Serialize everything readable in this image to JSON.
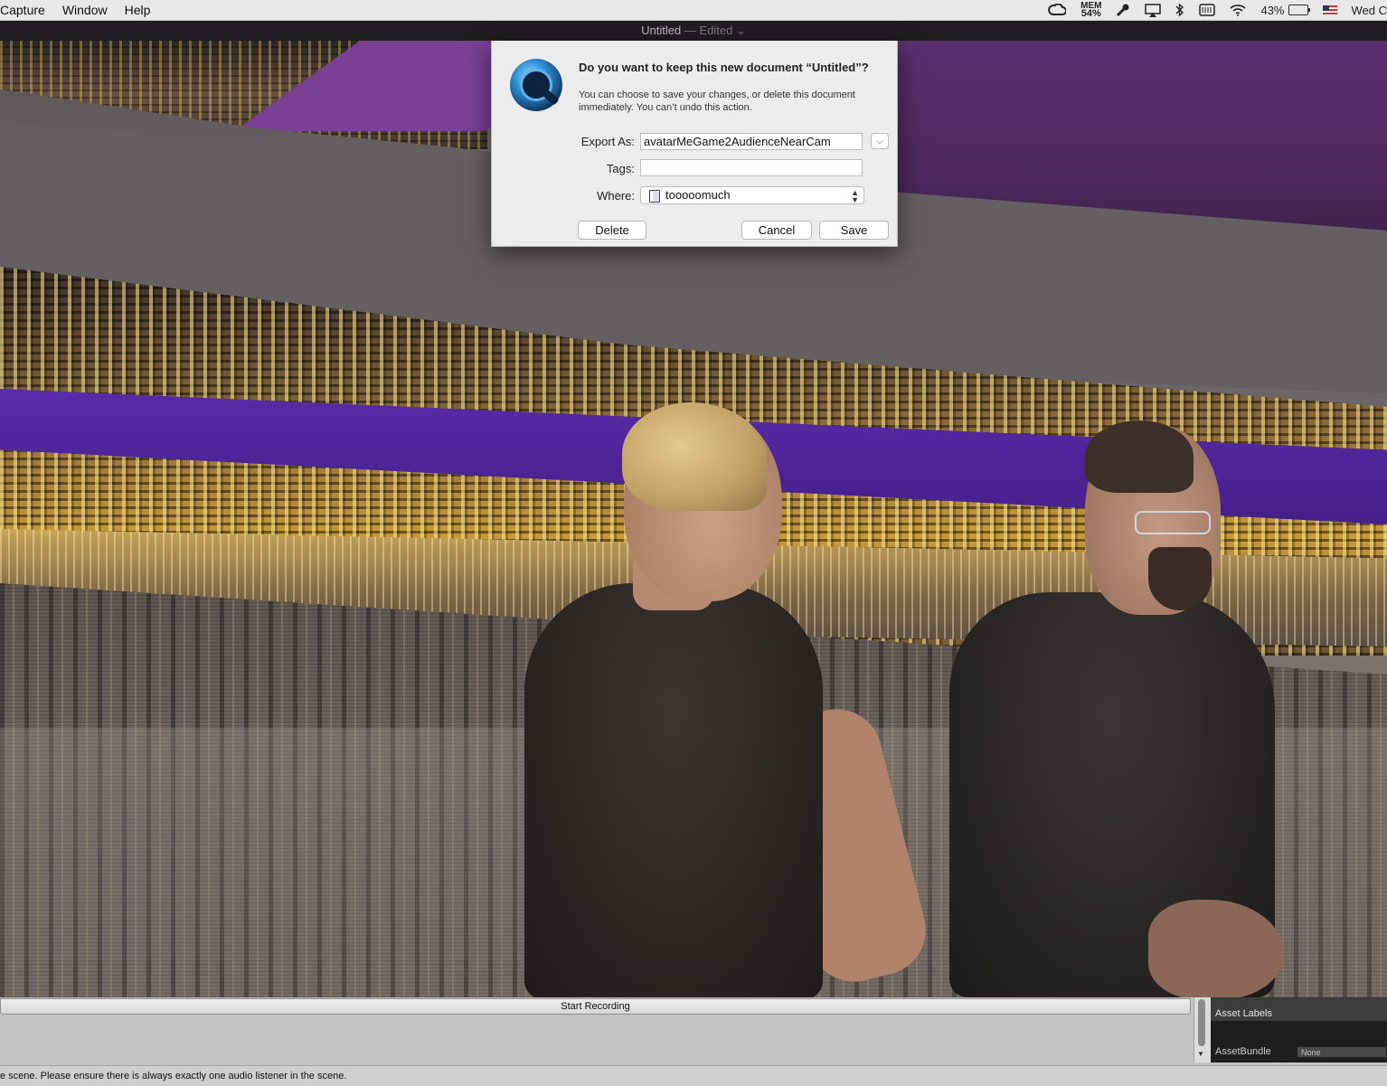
{
  "menubar": {
    "items": [
      "Capture",
      "Window",
      "Help"
    ],
    "status": {
      "mem_label": "MEM",
      "mem_value": "54%",
      "battery": "43%",
      "clock": "Wed C"
    }
  },
  "window": {
    "title": "Untitled",
    "edited_suffix": " — Edited",
    "edited_chevron": "⌄"
  },
  "dialog": {
    "title": "Do you want to keep this new document “Untitled”?",
    "message": "You can choose to save your changes, or delete this document immediately. You can’t undo this action.",
    "export_label": "Export As:",
    "export_value": "avatarMeGame2AudienceNearCam",
    "tags_label": "Tags:",
    "tags_value": "",
    "where_label": "Where:",
    "where_value": "tooooomuch",
    "buttons": {
      "delete": "Delete",
      "cancel": "Cancel",
      "save": "Save"
    }
  },
  "bottom": {
    "start_recording": "Start Recording",
    "inspector": {
      "asset_labels": "Asset Labels",
      "assetbundle_label": "AssetBundle",
      "assetbundle_value": "None"
    },
    "status_message": "e scene. Please ensure there is always exactly one audio listener in the scene."
  },
  "colors": {
    "accent_purple": "#5a2ba8",
    "dialog_bg": "#ececec"
  }
}
